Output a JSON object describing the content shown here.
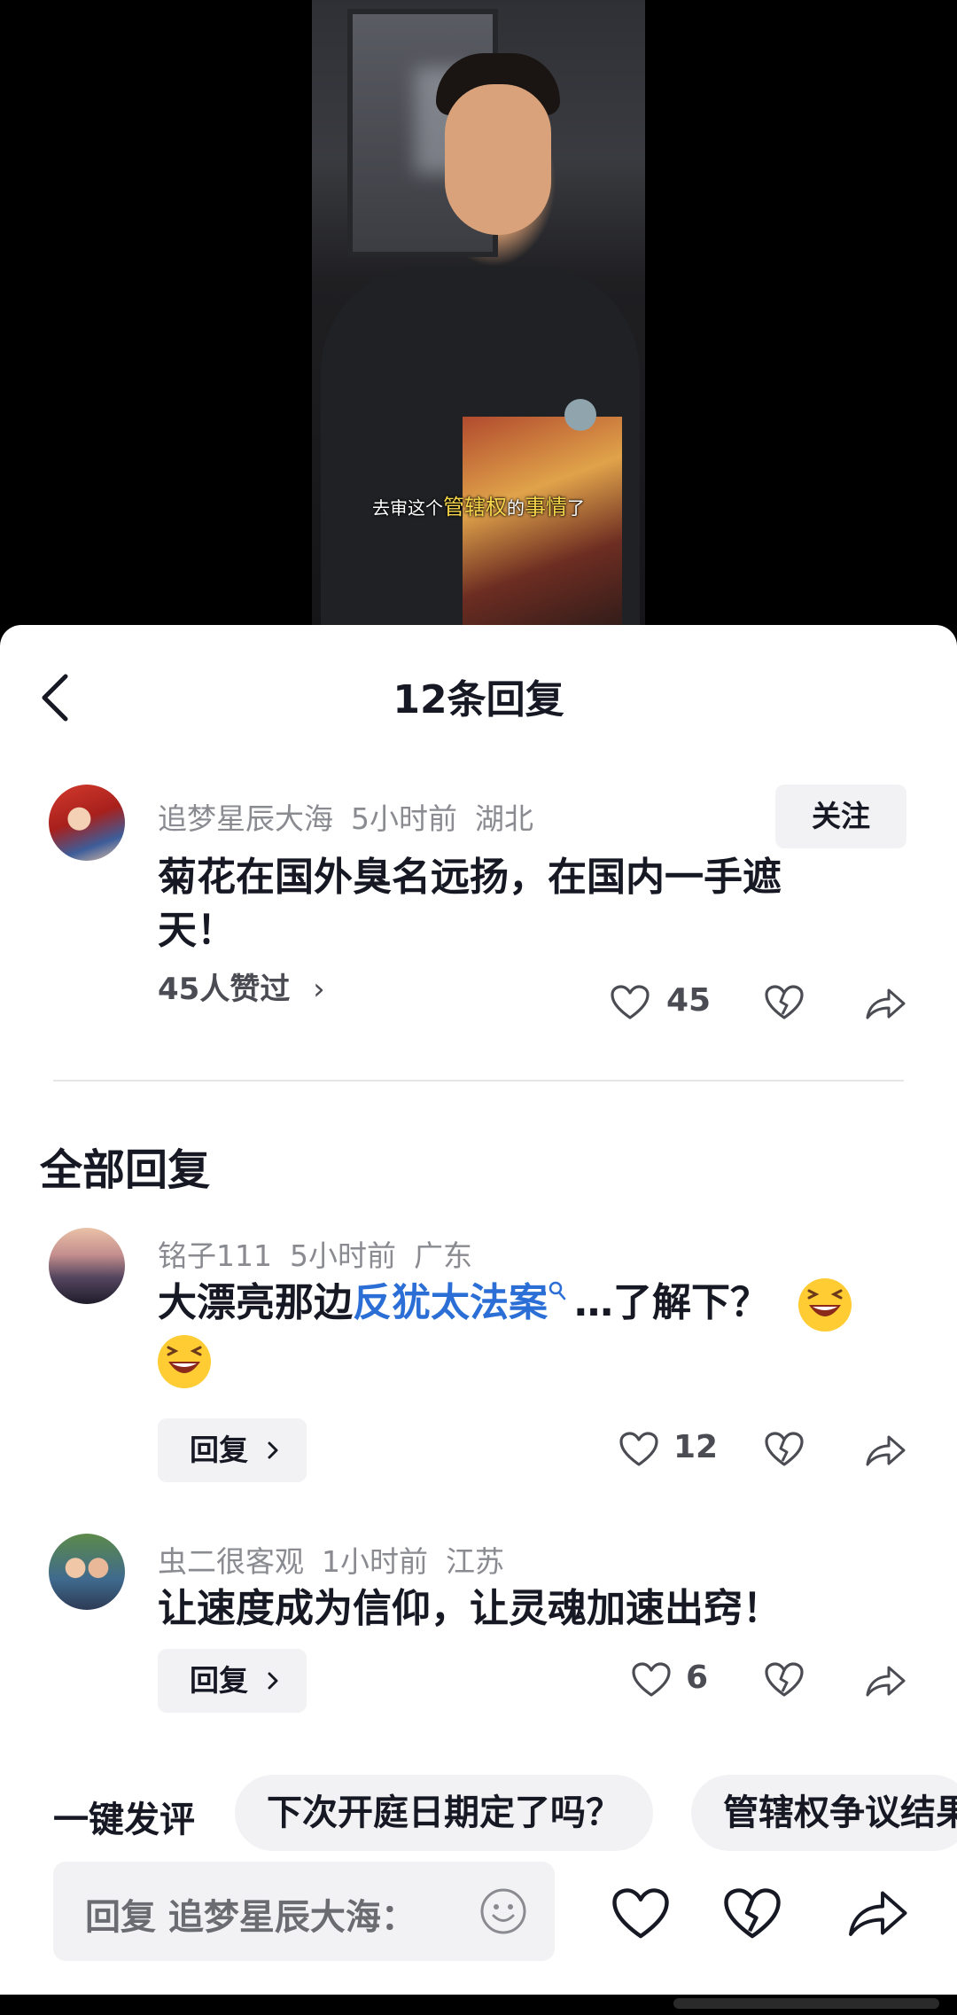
{
  "video": {
    "subtitle_prefix": "去审这个",
    "subtitle_hl1": "管辖权",
    "subtitle_mid": "的",
    "subtitle_hl2": "事情",
    "subtitle_suffix": "了"
  },
  "header": {
    "title": "12条回复"
  },
  "main_comment": {
    "user": "追梦星辰大海",
    "time": "5小时前",
    "location": "湖北",
    "follow_label": "关注",
    "text_line1": "菊花在国外臭名远扬，在国内一手遮",
    "text_line2": "天！",
    "likers": "45人赞过",
    "likers_chevron": "›",
    "like_count": "45"
  },
  "section_title": "全部回复",
  "replies": [
    {
      "user": "铭子111",
      "time": "5小时前",
      "location": "广东",
      "text_before": "大漂亮那边",
      "link_text": "反犹太法案",
      "text_after": "…了解下？",
      "reply_label": "回复",
      "like_count": "12"
    },
    {
      "user": "虫二很客观",
      "time": "1小时前",
      "location": "江苏",
      "text": "让速度成为信仰，让灵魂加速出窍！",
      "reply_label": "回复",
      "like_count": "6"
    }
  ],
  "quick_comment": {
    "label": "一键发评",
    "chips": [
      "下次开庭日期定了吗？",
      "管辖权争议结果"
    ]
  },
  "input": {
    "placeholder": "回复 追梦星辰大海："
  },
  "colors": {
    "link": "#2b6fd6",
    "text": "#161823",
    "muted": "#8a8b91",
    "chip_bg": "#f2f2f4"
  },
  "icons": [
    "back-arrow-icon",
    "heart-icon",
    "broken-heart-icon",
    "share-icon",
    "chevron-right-icon",
    "emoji-icon",
    "laughing-emoji-icon",
    "search-icon"
  ]
}
